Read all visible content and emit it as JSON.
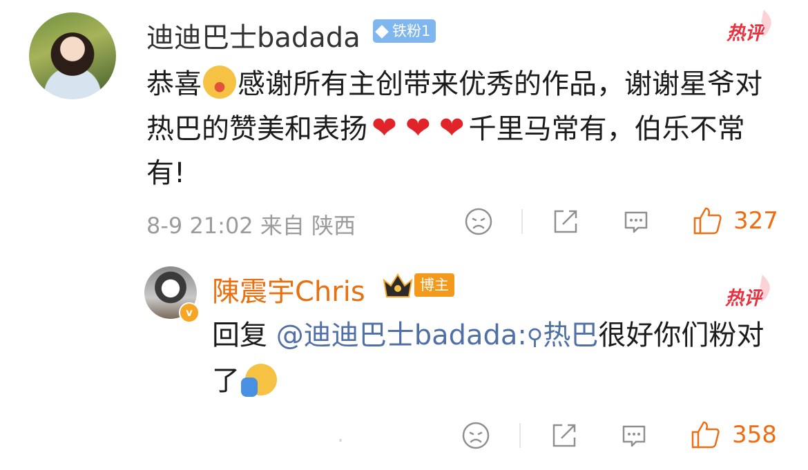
{
  "comment": {
    "user_name": "迪迪巴士badada",
    "fan_badge": "铁粉1",
    "hot_label": "热评",
    "text_part1": "恭喜",
    "text_part2": "感谢所有主创带来优秀的作品，谢谢星爷对热巴的赞美和表扬",
    "hearts": [
      "❤",
      "❤",
      "❤"
    ],
    "text_part3": "千里马常有，伯乐不常有!",
    "meta": "8-9 21:02 来自 陕西",
    "like_count": "327",
    "icons": [
      "sad-face-icon",
      "share-icon",
      "comment-icon",
      "thumbs-up-icon"
    ]
  },
  "reply": {
    "user_name": "陳震宇Chris",
    "badge": "博主",
    "verified_mark": "v",
    "hot_label": "热评",
    "prefix": "回复",
    "mention": "@迪迪巴士badada:",
    "search_glyph": "⚲",
    "topic": "热巴",
    "text": "很好你们粉对了",
    "meta": ".",
    "like_count": "358",
    "icons": [
      "sad-face-icon",
      "share-icon",
      "comment-icon",
      "thumbs-up-icon"
    ]
  },
  "colors": {
    "accent_orange": "#ef6c11",
    "hot_red": "#e8303f",
    "mention_blue": "#4f6fa6",
    "meta_gray": "#9b9b9b"
  }
}
